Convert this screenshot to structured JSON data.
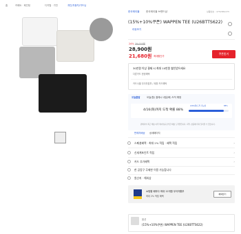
{
  "breadcrumb": [
    "홈",
    "카페트 · 페인팅",
    "디지털 · 가전",
    "개인/자동차/가드닝",
    "전체보기"
  ],
  "brand": "한국메이블",
  "brand_link": "한국메이블 브랜드샵",
  "top_right": "상품번호 : 4752882475",
  "product": {
    "title": "(15%+10%쿠폰) WAPPEN TEE (U26BTTS622)",
    "badge": "리뷰보기",
    "discount": "24%",
    "original_price": "39,000원",
    "price": "28,900원",
    "price_unit": "",
    "coupon_price": "21,680원",
    "coupon_label": "최대할인가",
    "coupon_btn": "쿠폰받기"
  },
  "benefit": {
    "line1": "30만원 이상 결제 시 최대 10만원 할인받으세요",
    "line2": "다른카드 한정혜택",
    "line3": "카드사별 무이자할부 / 제휴 카드혜택"
  },
  "shipping": {
    "tag": "오늘출발",
    "title": "오늘(월) 결제시 내일(화) 도착 예정",
    "date_text": "4/16(화)까지 도착 확률 88%",
    "bar_label": "4/16(화)도착 가능성",
    "bar_pct": "88%",
    "bar_fill": 0.88,
    "note": "판매자의 최근 배송 이력 데이터를 분석한 예상 도착일입니다. 지역, 상품에 따라 달라질 수 있습니다."
  },
  "tabs": [
    "판매자배송",
    "상세페이지"
  ],
  "rows": [
    "스페셜혜택 · 최대 2% 적립 · 혜택 적립",
    "신세계포인트 적립",
    "카드 추가혜택",
    "한 공동구 무제한 이용 가능합니다",
    "원산지 · 해외상"
  ],
  "ad": {
    "title": "쇼핑할 때마다 최대 12개월 무이자할부",
    "sub": "최대 2% 적립 혜택",
    "btn": "혜택받기"
  },
  "bottom": {
    "label": "옵션",
    "name": "(15%+10%쿠폰) WAPPEN TEE (U26BTTS622)"
  },
  "colors": {
    "accent": "#e5222b",
    "blue": "#2b5fd9",
    "ad_bg": "#f2f2f2"
  }
}
